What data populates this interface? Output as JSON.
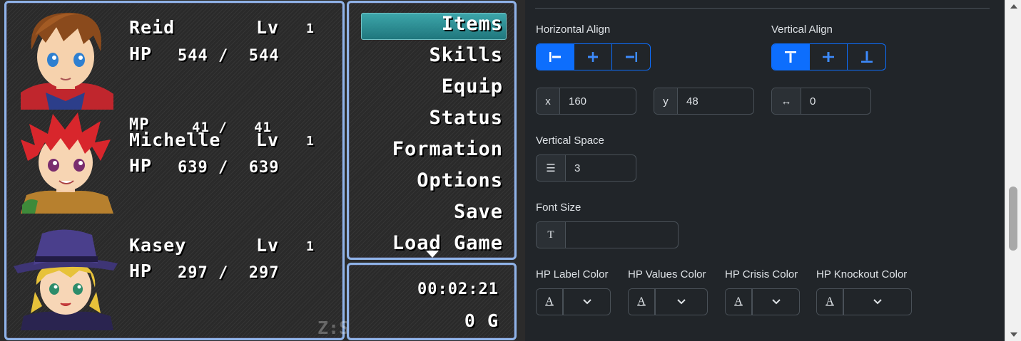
{
  "actors": [
    {
      "name": "Reid",
      "lv_label": "Lv",
      "lv": "1",
      "hp_label": "HP",
      "hp": "544 /  544"
    },
    {
      "name": "Michelle",
      "lv_label": "Lv",
      "lv": "1",
      "hp_label": "HP",
      "hp": "639 /  639",
      "mp_label": "MP",
      "mp": "41 /   41"
    },
    {
      "name": "Kasey",
      "lv_label": "Lv",
      "lv": "1",
      "hp_label": "HP",
      "hp": "297 /  297"
    }
  ],
  "help_text": "Z:Select  X:Back",
  "commands": [
    "Items",
    "Skills",
    "Equip",
    "Status",
    "Formation",
    "Options",
    "Save",
    "Load Game"
  ],
  "playtime": "00:02:21",
  "gold": "0 G",
  "settings": {
    "horizontal_align_label": "Horizontal Align",
    "vertical_align_label": "Vertical Align",
    "x_label": "x",
    "x_value": "160",
    "y_label": "y",
    "y_value": "48",
    "width_icon": "↔",
    "width_value": "0",
    "vertical_space_label": "Vertical Space",
    "vertical_space_icon": "☰",
    "vertical_space_value": "3",
    "font_size_label": "Font Size",
    "font_size_icon": "T",
    "font_size_value": "",
    "colors": [
      {
        "label": "HP Label Color",
        "icon": "A"
      },
      {
        "label": "HP Values Color",
        "icon": "A"
      },
      {
        "label": "HP Crisis Color",
        "icon": "A"
      },
      {
        "label": "HP Knockout Color",
        "icon": "A"
      }
    ],
    "accent": "#0d6efd"
  }
}
